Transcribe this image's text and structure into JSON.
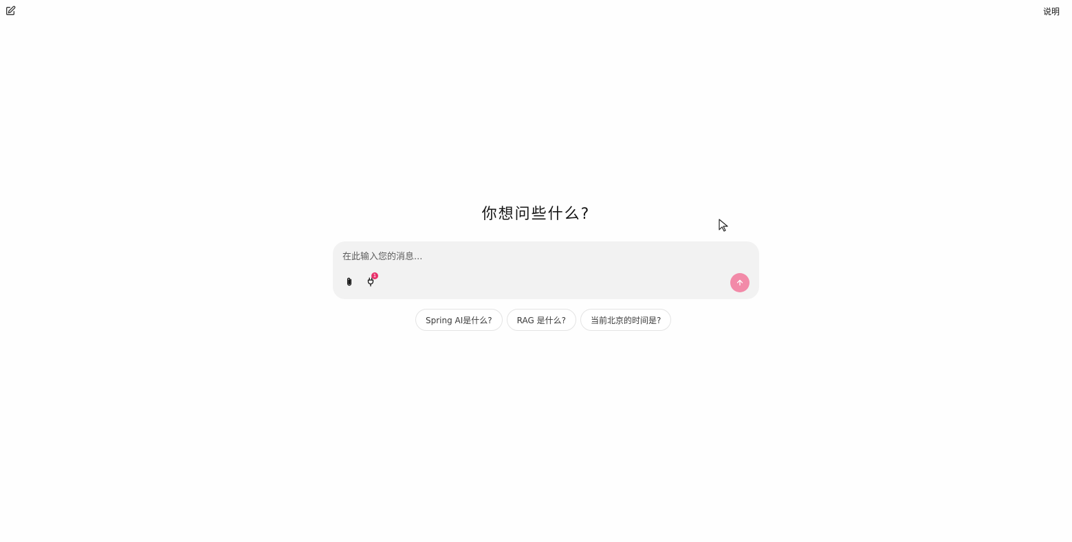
{
  "header": {
    "new_chat_icon": "edit-icon",
    "help_label": "说明"
  },
  "main": {
    "headline": "你想问些什么?",
    "composer": {
      "placeholder": "在此输入您的消息...",
      "attach_icon": "paperclip-icon",
      "plugin_icon": "plug-icon",
      "plugin_badge_count": "1",
      "send_icon": "arrow-up-icon"
    },
    "suggestions": [
      {
        "label": "Spring AI是什么?"
      },
      {
        "label": "RAG 是什么?"
      },
      {
        "label": "当前北京的时间是?"
      }
    ]
  },
  "colors": {
    "accent": "#e8306a",
    "send_button": "#f28aa8",
    "composer_bg": "#f2f2f2",
    "page_bg": "#fefefe"
  }
}
